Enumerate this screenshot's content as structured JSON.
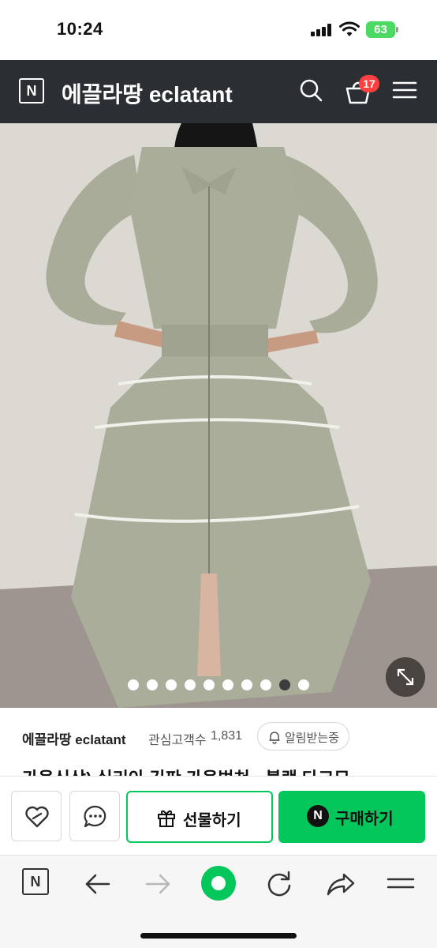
{
  "status_bar": {
    "time": "10:24",
    "battery": "63"
  },
  "header": {
    "logo_letter": "N",
    "title": "에끌라땅 eclatant",
    "cart_count": "17",
    "icons": [
      "search-icon",
      "cart-icon",
      "menu-icon"
    ]
  },
  "product": {
    "image_slides": 10,
    "active_slide": 9,
    "colors": {
      "dress": "#a9ad9a",
      "background_wall": "#dcd8d2",
      "floor": "#9e9590"
    }
  },
  "info": {
    "store_name": "에끌라땅 eclatant",
    "follower_label": "관심고객수",
    "follower_count": "1,831",
    "alarm_label": "알림받는중",
    "title_peek": "가을신상) 실리아 깃판 가을벌쳐 · 블랙 다크모"
  },
  "actions": {
    "gift_label": "선물하기",
    "buy_label": "구매하기",
    "buy_logo": "N",
    "accent": "#03c75a"
  },
  "browser": {
    "logo_letter": "N",
    "icons": [
      "naver-home-icon",
      "back-icon",
      "forward-icon",
      "green-dot-icon",
      "refresh-icon",
      "share-icon",
      "menu-icon"
    ]
  }
}
